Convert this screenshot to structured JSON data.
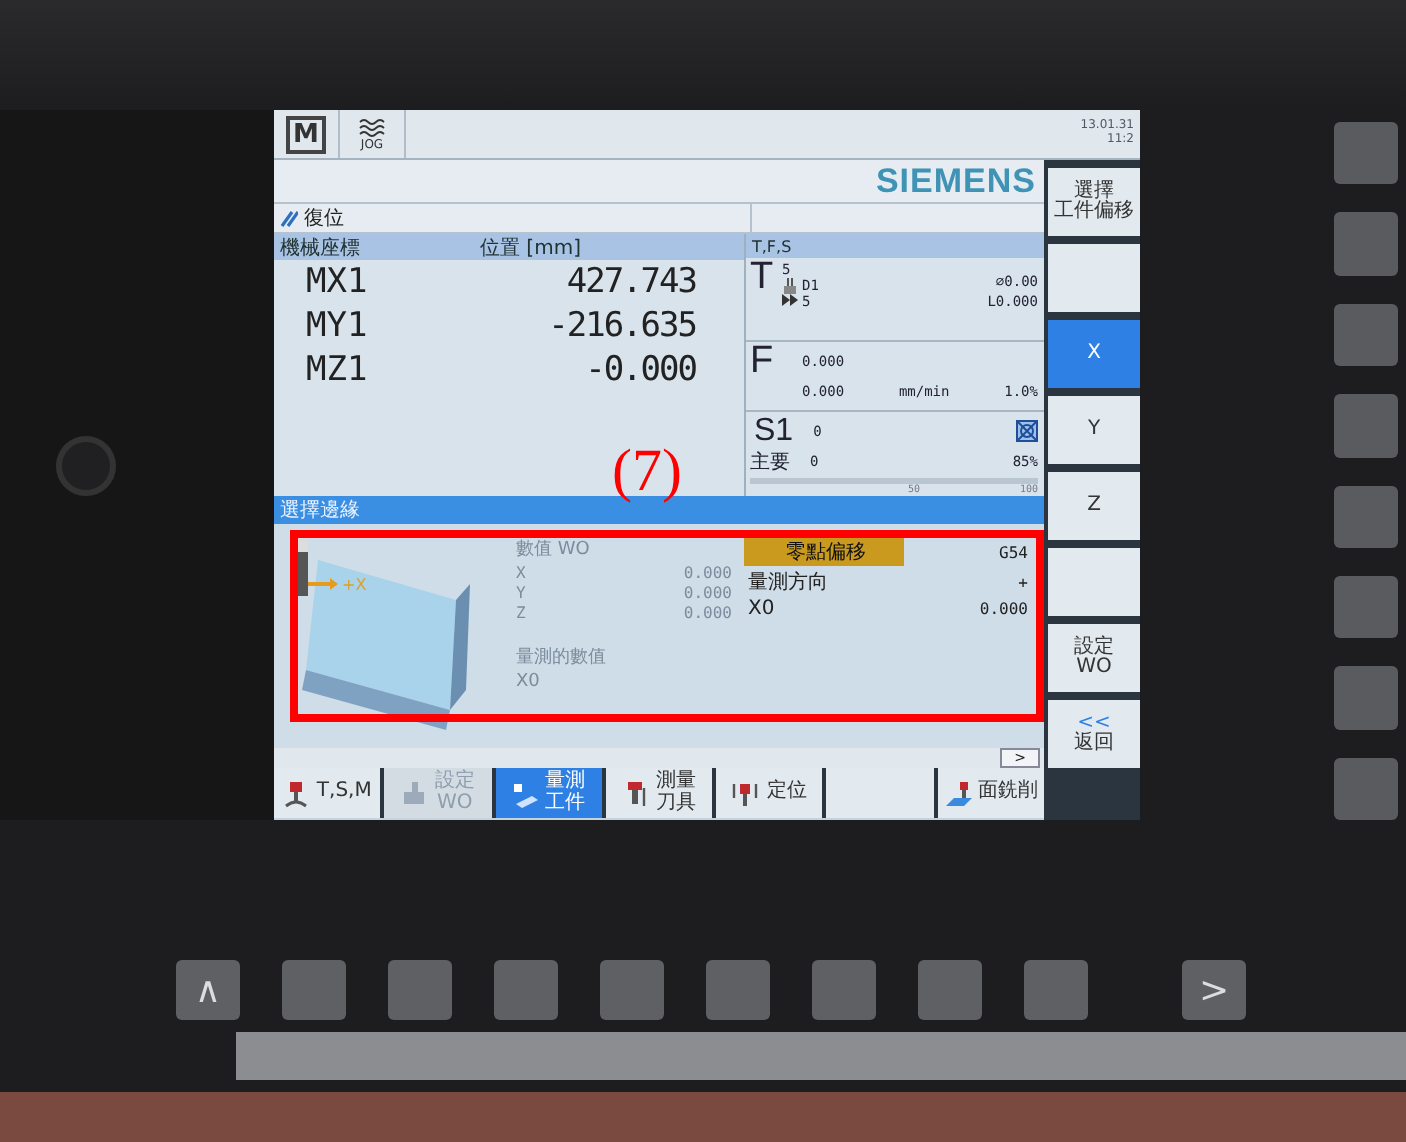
{
  "header": {
    "mode_key": "M",
    "mode_label": "JOG",
    "date": "13.01.31",
    "time": "11:2"
  },
  "brand": "SIEMENS",
  "channel_status": "復位",
  "positions": {
    "columns": [
      "機械座標",
      "位置 [mm]"
    ],
    "rows": [
      {
        "axis": "MX1",
        "value": "427.743"
      },
      {
        "axis": "MY1",
        "value": "-216.635"
      },
      {
        "axis": "MZ1",
        "value": "-0.000"
      }
    ]
  },
  "tfs": {
    "title": "T,F,S",
    "tool": {
      "label": "T",
      "number": "5",
      "edge": "D1",
      "next": "5",
      "diameter": "⌀0.00",
      "length": "L0.000"
    },
    "feed": {
      "label": "F",
      "actual": "0.000",
      "set": "0.000",
      "unit": "mm/min",
      "override": "1.0%"
    },
    "spindle": {
      "label": "S1",
      "actual": "0",
      "sub_label": "主要",
      "set": "0",
      "override": "85%",
      "scale": [
        "50",
        "100"
      ]
    }
  },
  "dialog": {
    "title": "選擇邊緣",
    "figure_label": "+X",
    "measured": {
      "disabled": true,
      "title": "數值 WO",
      "rows": [
        {
          "axis": "X",
          "value": "0.000"
        },
        {
          "axis": "Y",
          "value": "0.000"
        },
        {
          "axis": "Z",
          "value": "0.000"
        }
      ],
      "result_title": "量測的數值",
      "result_label": "X0"
    },
    "params": [
      {
        "label": "零點偏移",
        "value": "G54",
        "highlighted": true
      },
      {
        "label": "量測方向",
        "value": "+",
        "highlighted": false
      },
      {
        "label": "X0",
        "value": "0.000",
        "highlighted": false
      }
    ]
  },
  "scroll_button": ">",
  "side_softkeys": [
    {
      "lines": [
        "選擇",
        "工件偏移"
      ],
      "selected": false
    },
    {
      "selected": false
    },
    {
      "lines": [
        "X"
      ],
      "selected": true
    },
    {
      "lines": [
        "Y"
      ],
      "selected": false
    },
    {
      "lines": [
        "Z"
      ],
      "selected": false
    },
    {
      "selected": false
    },
    {
      "lines": [
        "設定",
        "WO"
      ],
      "selected": false
    },
    {
      "prefix": "<<",
      "lines": [
        "返回"
      ],
      "selected": false
    }
  ],
  "bottom_softkeys": [
    {
      "kind": "tsm",
      "lines": [
        "T,S,M"
      ],
      "selected": false,
      "disabled": false
    },
    {
      "kind": "setwo",
      "lines": [
        "設定",
        "WO"
      ],
      "selected": false,
      "disabled": true
    },
    {
      "kind": "workpiece",
      "lines": [
        "量測",
        "工件"
      ],
      "selected": true,
      "disabled": false
    },
    {
      "kind": "toolmeasure",
      "lines": [
        "測量",
        "刀具"
      ],
      "selected": false,
      "disabled": false
    },
    {
      "kind": "position",
      "lines": [
        "定位"
      ],
      "selected": false,
      "disabled": false
    },
    {
      "kind": "none",
      "selected": false,
      "disabled": false
    },
    {
      "kind": "facemill",
      "lines": [
        "面銑削"
      ],
      "selected": false,
      "disabled": false
    }
  ],
  "hardware_keys": {
    "left": "∧",
    "right": ">"
  },
  "annotation": {
    "label": "(7)"
  }
}
